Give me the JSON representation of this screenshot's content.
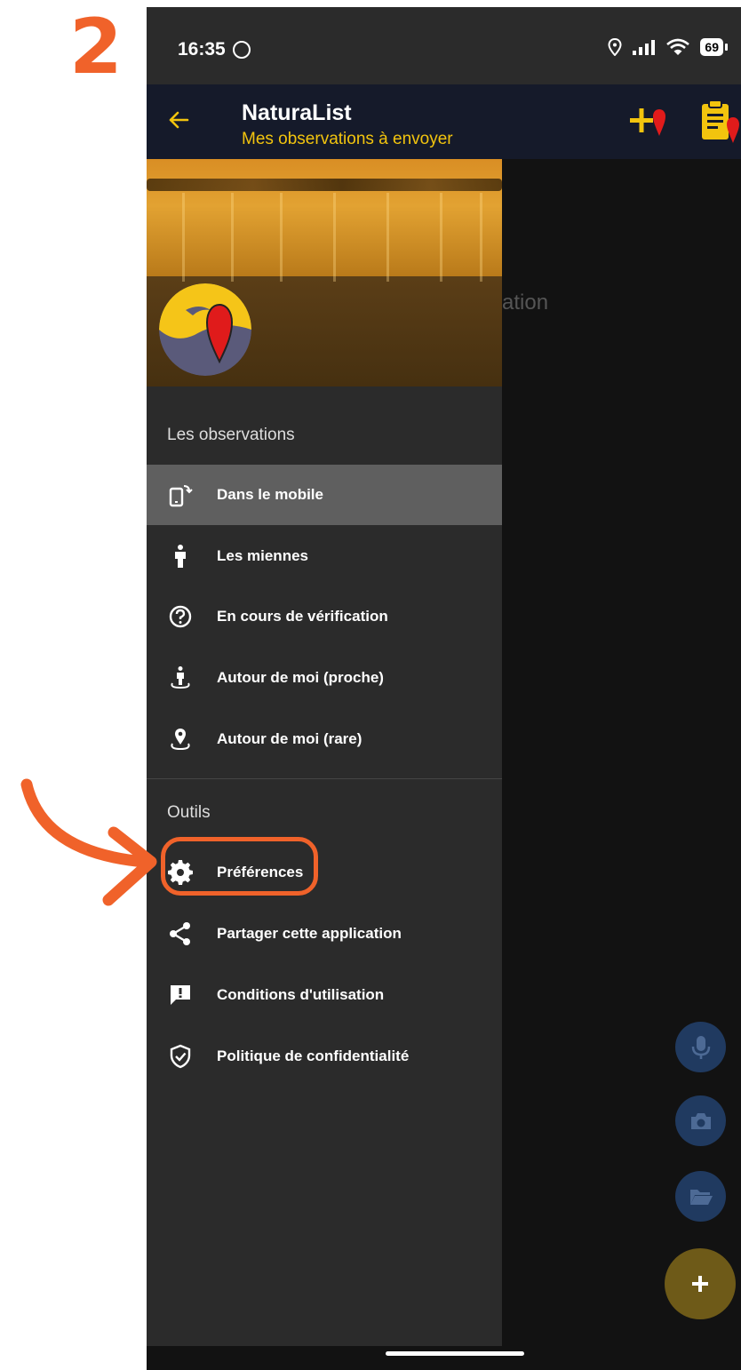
{
  "step_number": "2",
  "status_bar": {
    "time": "16:35",
    "battery": "69"
  },
  "app_bar": {
    "title": "NaturaList",
    "subtitle": "Mes observations à envoyer"
  },
  "main": {
    "partial_text": "vation"
  },
  "drawer": {
    "sections": [
      {
        "label": "Les observations",
        "items": [
          {
            "label": "Dans le mobile",
            "icon": "mobile-sync-icon",
            "active": true
          },
          {
            "label": "Les miennes",
            "icon": "person-icon"
          },
          {
            "label": "En cours de vérification",
            "icon": "question-circle-icon"
          },
          {
            "label": "Autour de moi (proche)",
            "icon": "person-nearby-icon"
          },
          {
            "label": "Autour de moi (rare)",
            "icon": "location-pin-icon"
          }
        ]
      },
      {
        "label": "Outils",
        "items": [
          {
            "label": "Préférences",
            "icon": "gear-icon",
            "highlighted": true
          },
          {
            "label": "Partager cette application",
            "icon": "share-icon"
          },
          {
            "label": "Conditions d'utilisation",
            "icon": "feedback-icon"
          },
          {
            "label": "Politique de confidentialité",
            "icon": "shield-check-icon"
          }
        ]
      }
    ]
  },
  "colors": {
    "accent": "#F2C40E",
    "annotation": "#F0622A",
    "drawer_bg": "#2b2b2b",
    "active_item_bg": "#5f5f5f",
    "fab_blue": "#203a60",
    "fab_gold": "#6e5a18"
  }
}
